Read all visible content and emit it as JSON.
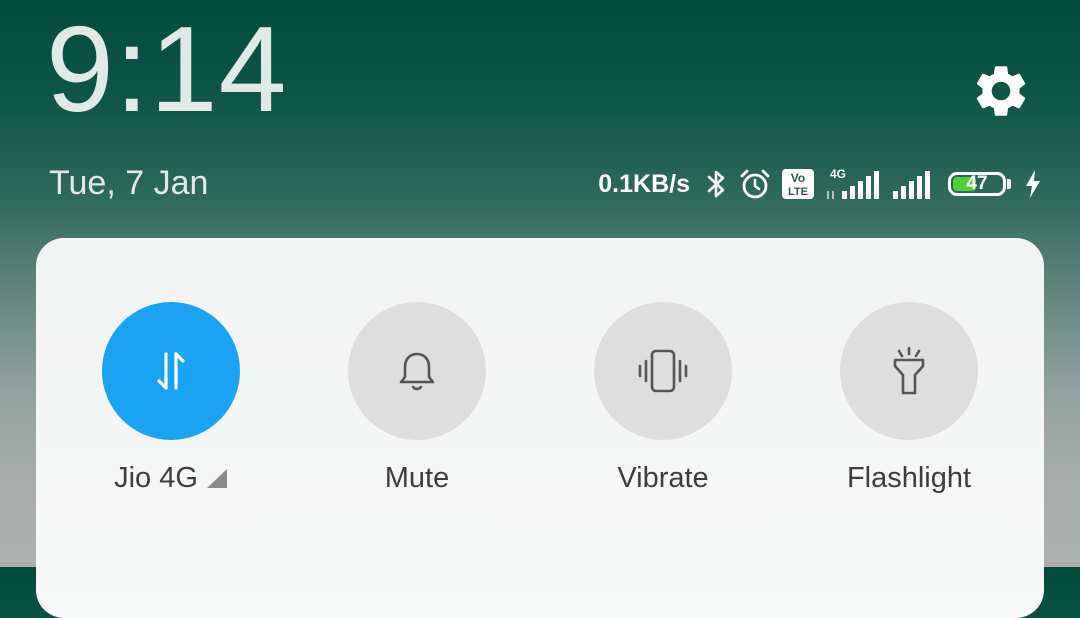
{
  "header": {
    "time": "9:14",
    "date": "Tue, 7 Jan",
    "settings_icon": "gear-icon"
  },
  "status_bar": {
    "net_speed": "0.1KB/s",
    "icons": [
      "bluetooth-icon",
      "alarm-icon",
      "volte-icon",
      "signal-4g-icon",
      "signal-icon",
      "charging-icon"
    ],
    "volte_top": "Vo",
    "volte_bottom": "LTE",
    "network_type": "4G",
    "battery_level": "47",
    "battery_fraction": 0.47,
    "battery_fill_color": "#4cd137"
  },
  "quick_toggles": [
    {
      "label": "Jio 4G",
      "icon": "mobile-data-icon",
      "active": true
    },
    {
      "label": "Mute",
      "icon": "bell-icon",
      "active": false
    },
    {
      "label": "Vibrate",
      "icon": "vibrate-icon",
      "active": false
    },
    {
      "label": "Flashlight",
      "icon": "flashlight-icon",
      "active": false
    }
  ],
  "colors": {
    "accent": "#1aa3f5",
    "inactive_toggle": "#dedede",
    "panel_bg": "#f4f5f5"
  }
}
